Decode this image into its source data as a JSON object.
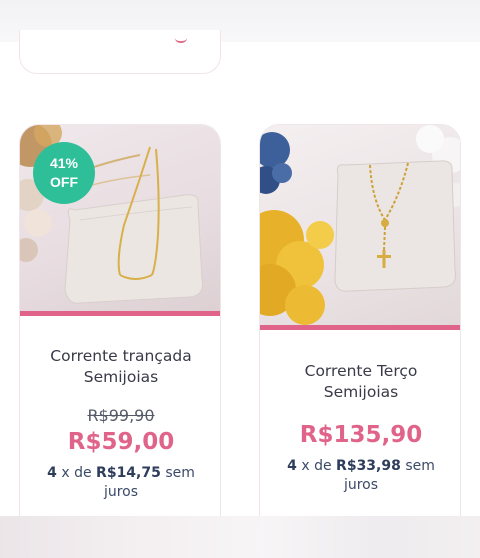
{
  "products": [
    {
      "badge": {
        "line1": "41%",
        "line2": "OFF"
      },
      "name_line1": "Corrente trançada",
      "name_line2": "Semijoias",
      "old_price": "R$99,90",
      "price": "R$59,00",
      "installments": {
        "count": "4",
        "x_de": "x de",
        "value": "R$14,75",
        "suffix": "sem",
        "suffix2": "juros"
      },
      "image_icon": "gold-chain-necklace-photo"
    },
    {
      "name_line1": "Corrente Terço",
      "name_line2": "Semijoias",
      "price": "R$135,90",
      "installments": {
        "count": "4",
        "x_de": "x de",
        "value": "R$33,98",
        "suffix": "sem",
        "suffix2": "juros"
      },
      "image_icon": "rosary-necklace-photo"
    }
  ],
  "colors": {
    "accent_pink": "#e0648a",
    "badge_green": "#2ebf99",
    "text_dark": "#3a3a48",
    "install_text": "#3b4a68"
  }
}
